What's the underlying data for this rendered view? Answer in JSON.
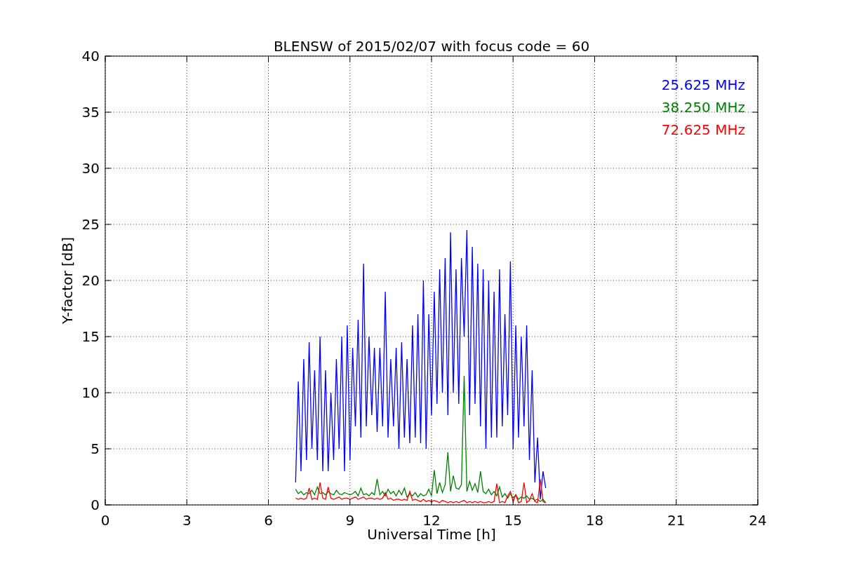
{
  "chart_data": {
    "type": "line",
    "title": "BLENSW of 2015/02/07 with focus code = 60",
    "xlabel": "Universal Time [h]",
    "ylabel": "Y-factor [dB]",
    "grid": true,
    "xlim": [
      0,
      24
    ],
    "ylim": [
      0,
      40
    ],
    "xticks": [
      0,
      3,
      6,
      9,
      12,
      15,
      18,
      21,
      24
    ],
    "yticks": [
      0,
      5,
      10,
      15,
      20,
      25,
      30,
      35,
      40
    ],
    "x": [
      7.0,
      7.1,
      7.2,
      7.3,
      7.4,
      7.5,
      7.6,
      7.7,
      7.8,
      7.9,
      8.0,
      8.1,
      8.2,
      8.3,
      8.4,
      8.5,
      8.6,
      8.7,
      8.8,
      8.9,
      9.0,
      9.1,
      9.2,
      9.3,
      9.4,
      9.5,
      9.6,
      9.7,
      9.8,
      9.9,
      10.0,
      10.1,
      10.2,
      10.3,
      10.4,
      10.5,
      10.6,
      10.7,
      10.8,
      10.9,
      11.0,
      11.1,
      11.2,
      11.3,
      11.4,
      11.5,
      11.6,
      11.7,
      11.8,
      11.9,
      12.0,
      12.1,
      12.2,
      12.3,
      12.4,
      12.5,
      12.6,
      12.7,
      12.8,
      12.9,
      13.0,
      13.1,
      13.2,
      13.3,
      13.4,
      13.5,
      13.6,
      13.7,
      13.8,
      13.9,
      14.0,
      14.1,
      14.2,
      14.3,
      14.4,
      14.5,
      14.6,
      14.7,
      14.8,
      14.9,
      15.0,
      15.1,
      15.2,
      15.3,
      15.4,
      15.5,
      15.6,
      15.7,
      15.8,
      15.9,
      16.0,
      16.1,
      16.2
    ],
    "series": [
      {
        "name": "25.625 MHz",
        "color": "#0000ff",
        "values": [
          2,
          11,
          3,
          13,
          4,
          14.5,
          5,
          12,
          4,
          15,
          3,
          12,
          3,
          10,
          4,
          13,
          5,
          15,
          3,
          16,
          4,
          14,
          7,
          16.5,
          6,
          21.5,
          7,
          15,
          8,
          14,
          6.5,
          14,
          7,
          19,
          6,
          13,
          7,
          14,
          5,
          14.5,
          6,
          13,
          5.5,
          16,
          6,
          17,
          5.5,
          20,
          5,
          17,
          8,
          19,
          9,
          21,
          10,
          22,
          8,
          24.3,
          10,
          21,
          9,
          22,
          15,
          24.5,
          8,
          23,
          9,
          21.5,
          7,
          21,
          5,
          20,
          6,
          19,
          6,
          21,
          7,
          17,
          8,
          21.7,
          5,
          16,
          6,
          15,
          7,
          16,
          4,
          12,
          2,
          6,
          0.5,
          3,
          1.5
        ]
      },
      {
        "name": "38.250 MHz",
        "color": "#008000",
        "values": [
          1.4,
          1.0,
          1.2,
          0.9,
          1.1,
          1.0,
          1.3,
          0.9,
          1.6,
          1.0,
          1.1,
          0.9,
          1.2,
          1.0,
          0.9,
          1.3,
          1.0,
          0.9,
          1.1,
          1.0,
          0.9,
          1.0,
          1.2,
          0.8,
          1.5,
          0.9,
          1.0,
          0.8,
          1.1,
          0.9,
          2.3,
          0.9,
          1.2,
          0.8,
          1.4,
          1.0,
          1.2,
          0.8,
          1.3,
          0.9,
          1.5,
          0.7,
          1.0,
          0.8,
          1.1,
          0.7,
          1.0,
          0.8,
          0.9,
          1.4,
          0.8,
          3.1,
          1.0,
          2.0,
          1.1,
          1.8,
          4.7,
          1.2,
          2.6,
          1.5,
          1.4,
          1.8,
          11.5,
          1.2,
          2.1,
          1.3,
          1.9,
          1.1,
          3.0,
          1.2,
          1.0,
          1.4,
          0.9,
          1.2,
          0.8,
          1.6,
          0.7,
          1.0,
          0.6,
          1.0,
          0.6,
          0.9,
          0.5,
          0.7,
          0.6,
          0.8,
          0.5,
          0.6,
          0.4,
          0.5,
          0.3,
          0.5,
          0.2
        ]
      },
      {
        "name": "72.625 MHz",
        "color": "#ff0000",
        "values": [
          0.6,
          0.5,
          0.6,
          0.5,
          0.6,
          1.5,
          0.5,
          0.6,
          0.5,
          2.0,
          0.6,
          0.5,
          1.6,
          0.6,
          0.5,
          0.6,
          0.7,
          0.5,
          0.6,
          0.6,
          0.5,
          0.6,
          0.7,
          0.5,
          0.6,
          0.7,
          0.5,
          0.6,
          0.6,
          0.5,
          0.6,
          0.5,
          0.6,
          1.1,
          0.5,
          0.6,
          0.4,
          0.5,
          0.5,
          0.4,
          0.5,
          0.4,
          1.2,
          0.4,
          0.5,
          0.4,
          0.3,
          0.5,
          0.3,
          0.4,
          0.3,
          0.4,
          0.3,
          0.2,
          0.4,
          0.3,
          0.2,
          0.3,
          0.2,
          0.3,
          0.2,
          0.3,
          0.4,
          0.2,
          0.3,
          0.2,
          0.3,
          0.2,
          0.3,
          0.2,
          0.2,
          0.3,
          0.2,
          0.3,
          1.9,
          0.2,
          0.3,
          0.2,
          0.8,
          1.2,
          0.3,
          0.9,
          0.2,
          0.3,
          2.0,
          0.2,
          0.4,
          1.0,
          0.3,
          0.2,
          2.3,
          0.3,
          0.2
        ]
      }
    ]
  }
}
